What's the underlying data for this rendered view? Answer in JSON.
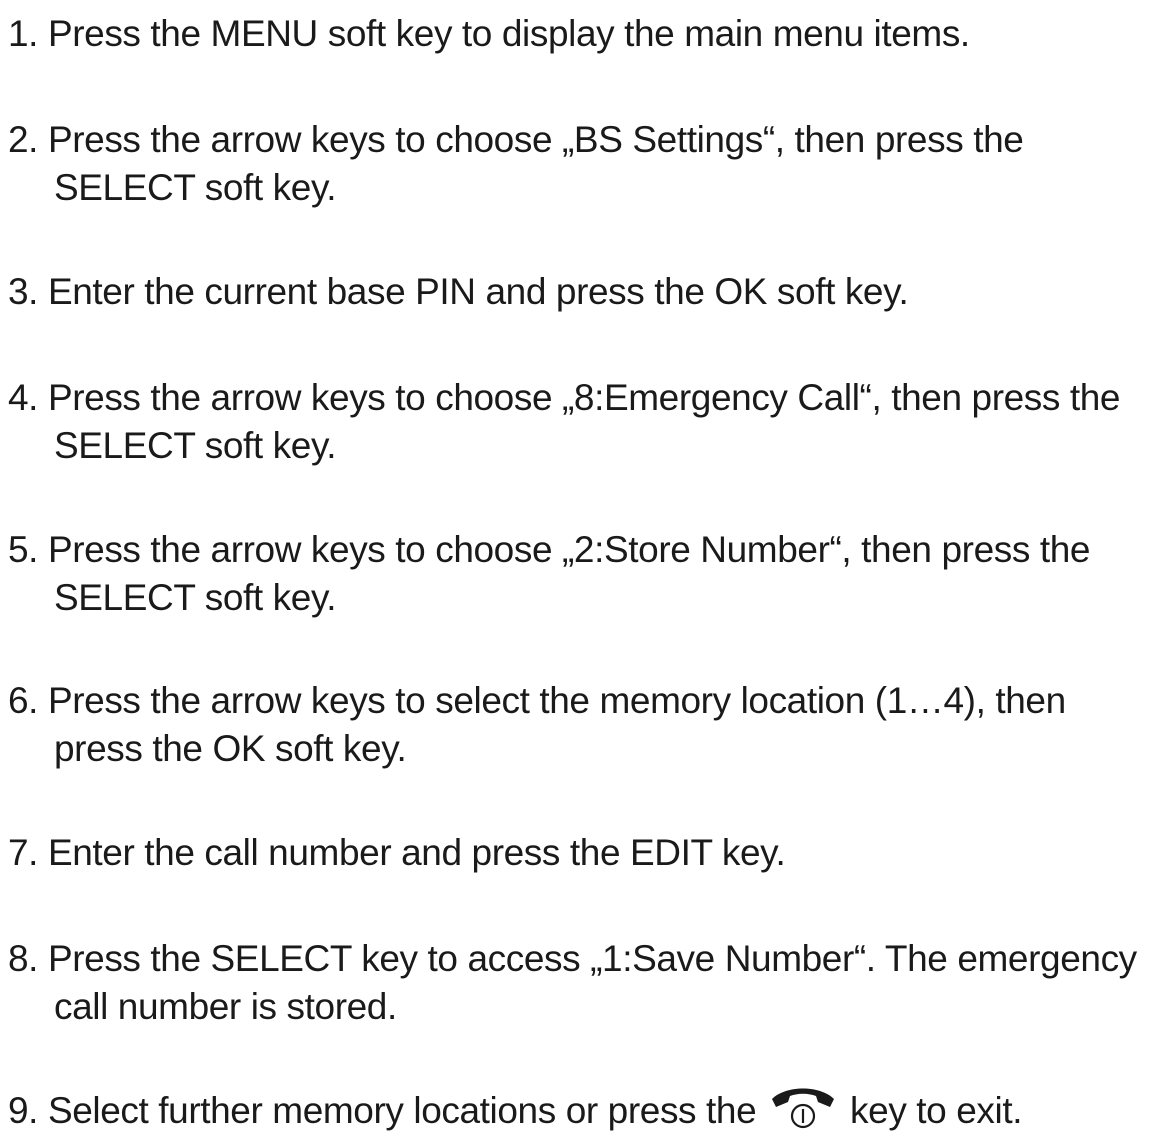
{
  "steps": [
    {
      "num": "1.",
      "line1": "Press the MENU soft key to display the main menu items.",
      "line2": ""
    },
    {
      "num": "2.",
      "line1": "Press the arrow keys to choose „BS Settings“, then press the",
      "line2": "SELECT soft key."
    },
    {
      "num": "3.",
      "line1": "Enter the current base PIN and press the OK soft key.",
      "line2": ""
    },
    {
      "num": "4.",
      "line1": "Press the arrow keys to choose „8:Emergency Call“, then press the",
      "line2": "SELECT soft key."
    },
    {
      "num": "5.",
      "line1": "Press the arrow keys to choose „2:Store Number“, then press the",
      "line2": "SELECT soft key."
    },
    {
      "num": "6.",
      "line1": "Press the arrow keys to select the memory location (1…4), then",
      "line2": "press the OK soft key."
    },
    {
      "num": "7.",
      "line1": "Enter the call number and press the EDIT key.",
      "line2": ""
    },
    {
      "num": "8.",
      "line1": "Press the SELECT key to access „1:Save Number“. The emergency",
      "line2": "call number is stored."
    },
    {
      "num": "9.",
      "line1_before_icon": "Select further memory locations or press the",
      "line1_after_icon": "key to exit.",
      "icon": "end-call-icon"
    }
  ]
}
